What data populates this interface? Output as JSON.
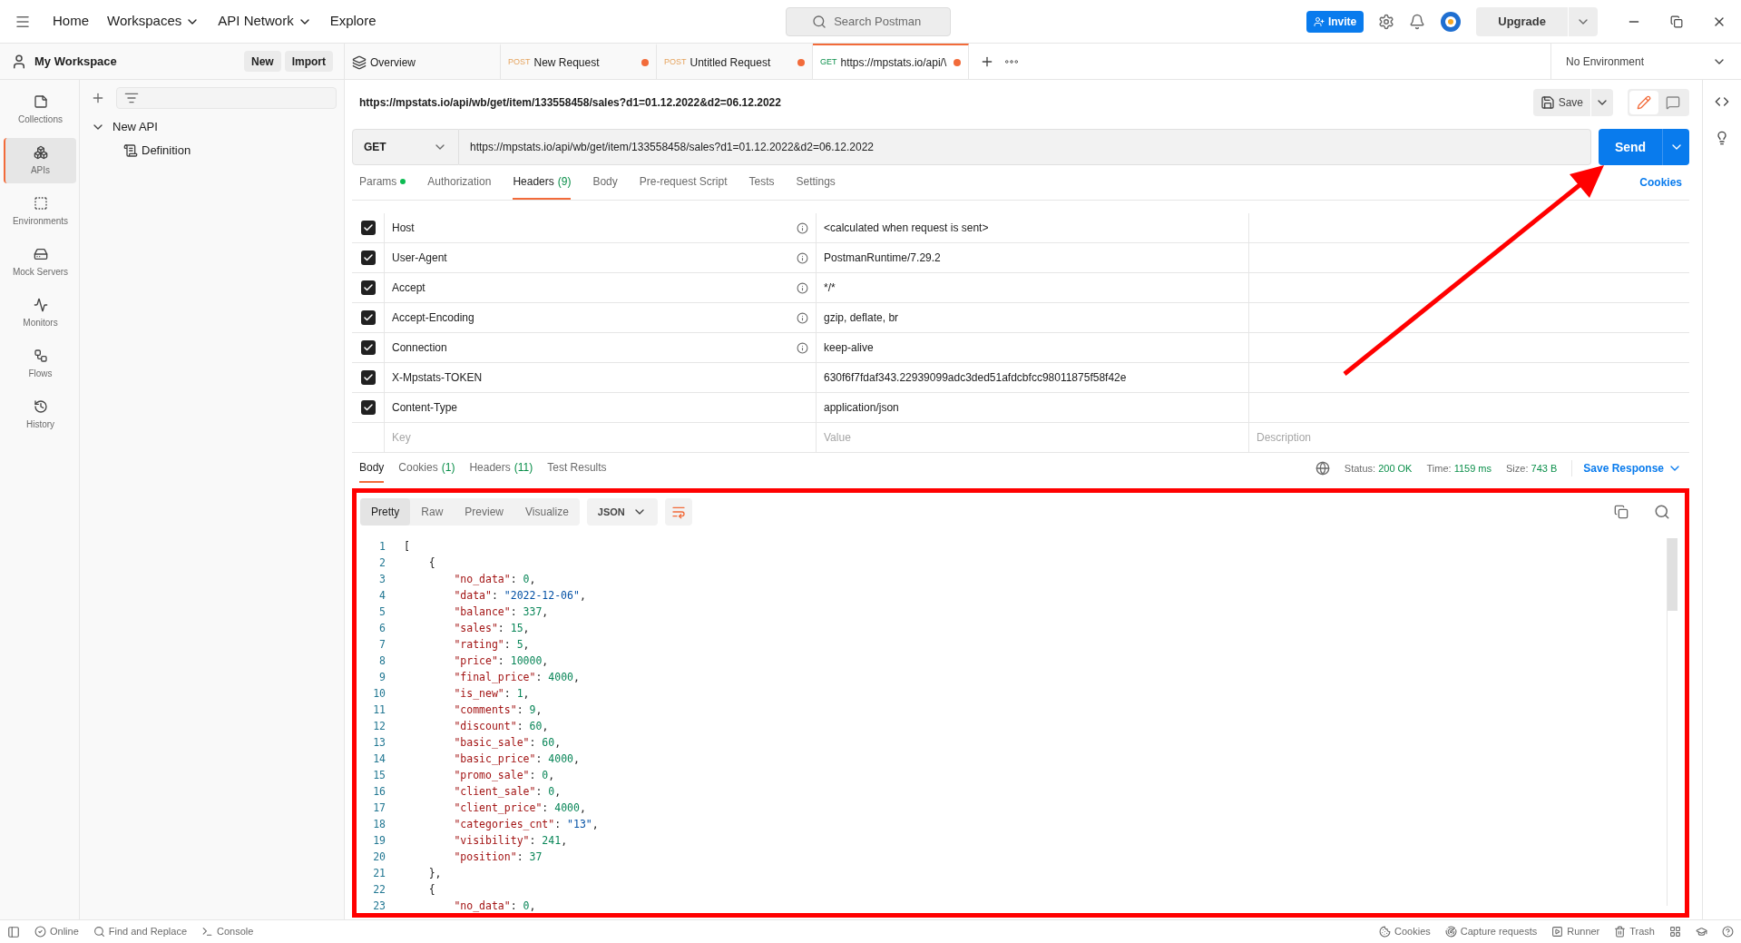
{
  "top_bar": {
    "nav": [
      {
        "label": "Home",
        "dropdown": false
      },
      {
        "label": "Workspaces",
        "dropdown": true
      },
      {
        "label": "API Network",
        "dropdown": true
      },
      {
        "label": "Explore",
        "dropdown": false
      }
    ],
    "search": {
      "placeholder": "Search Postman"
    },
    "invite": "Invite",
    "upgrade": "Upgrade"
  },
  "workspace": {
    "title": "My Workspace",
    "buttons": [
      "New",
      "Import"
    ]
  },
  "sidebar": {
    "items": [
      {
        "label": "Collections",
        "selected": false
      },
      {
        "label": "APIs",
        "selected": true
      },
      {
        "label": "Environments",
        "selected": false
      },
      {
        "label": "Mock Servers",
        "selected": false
      },
      {
        "label": "Monitors",
        "selected": false
      },
      {
        "label": "Flows",
        "selected": false
      },
      {
        "label": "History",
        "selected": false
      }
    ]
  },
  "tree": {
    "items": [
      {
        "label": "New API",
        "expanded": true,
        "children": [
          {
            "label": "Definition"
          }
        ]
      }
    ]
  },
  "tabs": [
    {
      "kind": "overview",
      "label": "Overview",
      "unsaved": false,
      "selected": false
    },
    {
      "kind": "post",
      "method": "POST",
      "label": "New Request",
      "unsaved": true,
      "selected": false
    },
    {
      "kind": "post",
      "method": "POST",
      "label": "Untitled Request",
      "unsaved": true,
      "selected": false
    },
    {
      "kind": "get",
      "method": "GET",
      "label": "https://mpstats.io/api/\\",
      "unsaved": true,
      "selected": true
    }
  ],
  "environment": "No Environment",
  "request": {
    "title": "https://mpstats.io/api/wb/get/item/133558458/sales?d1=01.12.2022&d2=06.12.2022",
    "save": "Save",
    "method": "GET",
    "url": "https://mpstats.io/api/wb/get/item/133558458/sales?d1=01.12.2022&d2=06.12.2022",
    "send": "Send"
  },
  "request_tabs": [
    {
      "label": "Params",
      "dot": true,
      "selected": false
    },
    {
      "label": "Authorization",
      "dot": false,
      "selected": false
    },
    {
      "label": "Headers",
      "count": "(9)",
      "dot": false,
      "selected": true
    },
    {
      "label": "Body",
      "dot": false,
      "selected": false
    },
    {
      "label": "Pre-request Script",
      "dot": false,
      "selected": false
    },
    {
      "label": "Tests",
      "dot": false,
      "selected": false
    },
    {
      "label": "Settings",
      "dot": false,
      "selected": false
    }
  ],
  "cookies_link": "Cookies",
  "headers": {
    "rows": [
      {
        "checked": true,
        "key": "Host",
        "auto": true,
        "value": "<calculated when request is sent>"
      },
      {
        "checked": true,
        "key": "User-Agent",
        "auto": true,
        "value": "PostmanRuntime/7.29.2"
      },
      {
        "checked": true,
        "key": "Accept",
        "auto": true,
        "value": "*/*"
      },
      {
        "checked": true,
        "key": "Accept-Encoding",
        "auto": true,
        "value": "gzip, deflate, br"
      },
      {
        "checked": true,
        "key": "Connection",
        "auto": true,
        "value": "keep-alive"
      },
      {
        "checked": true,
        "key": "X-Mpstats-TOKEN",
        "auto": false,
        "value": "630f6f7fdaf343.22939099adc3ded51afdcbfcc98011875f58f42e"
      },
      {
        "checked": true,
        "key": "Content-Type",
        "auto": false,
        "value": "application/json"
      }
    ],
    "placeholder_row": {
      "key": "Key",
      "value": "Value",
      "description": "Description"
    }
  },
  "response": {
    "tabs": [
      {
        "label": "Body",
        "selected": true
      },
      {
        "label": "Cookies",
        "count": "(1)",
        "selected": false
      },
      {
        "label": "Headers",
        "count": "(11)",
        "selected": false
      },
      {
        "label": "Test Results",
        "selected": false
      }
    ],
    "stats": [
      {
        "label": "Status:",
        "value": "200 OK"
      },
      {
        "label": "Time:",
        "value": "1159 ms"
      },
      {
        "label": "Size:",
        "value": "743 B"
      }
    ],
    "save_response": "Save Response",
    "views": [
      {
        "label": "Pretty",
        "selected": true
      },
      {
        "label": "Raw",
        "selected": false
      },
      {
        "label": "Preview",
        "selected": false
      },
      {
        "label": "Visualize",
        "selected": false
      }
    ],
    "format": "JSON",
    "code": [
      {
        "n": "1",
        "text": "["
      },
      {
        "n": "2",
        "text": "    {"
      },
      {
        "n": "3",
        "text": "        \"no_data\": 0,"
      },
      {
        "n": "4",
        "text": "        \"data\": \"2022-12-06\","
      },
      {
        "n": "5",
        "text": "        \"balance\": 337,"
      },
      {
        "n": "6",
        "text": "        \"sales\": 15,"
      },
      {
        "n": "7",
        "text": "        \"rating\": 5,"
      },
      {
        "n": "8",
        "text": "        \"price\": 10000,"
      },
      {
        "n": "9",
        "text": "        \"final_price\": 4000,"
      },
      {
        "n": "10",
        "text": "        \"is_new\": 1,"
      },
      {
        "n": "11",
        "text": "        \"comments\": 9,"
      },
      {
        "n": "12",
        "text": "        \"discount\": 60,"
      },
      {
        "n": "13",
        "text": "        \"basic_sale\": 60,"
      },
      {
        "n": "14",
        "text": "        \"basic_price\": 4000,"
      },
      {
        "n": "15",
        "text": "        \"promo_sale\": 0,"
      },
      {
        "n": "16",
        "text": "        \"client_sale\": 0,"
      },
      {
        "n": "17",
        "text": "        \"client_price\": 4000,"
      },
      {
        "n": "18",
        "text": "        \"categories_cnt\": \"13\","
      },
      {
        "n": "19",
        "text": "        \"visibility\": 241,"
      },
      {
        "n": "20",
        "text": "        \"position\": 37"
      },
      {
        "n": "21",
        "text": "    },"
      },
      {
        "n": "22",
        "text": "    {"
      },
      {
        "n": "23",
        "text": "        \"no_data\": 0,"
      }
    ]
  },
  "status_bar": {
    "left": [
      "Online",
      "Find and Replace",
      "Console"
    ],
    "right": [
      "Cookies",
      "Capture requests",
      "Runner",
      "Trash"
    ]
  }
}
